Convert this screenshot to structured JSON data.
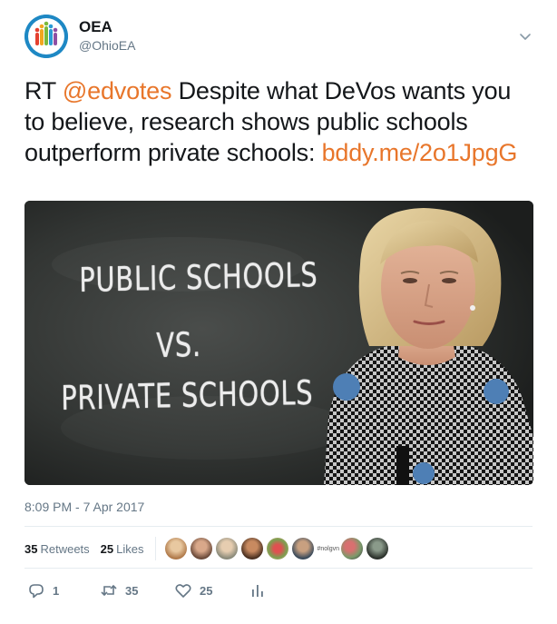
{
  "account": {
    "display_name": "OEA",
    "handle": "@OhioEA",
    "avatar_icon": "oea-logo-icon",
    "more_icon": "chevron-down-icon"
  },
  "tweet": {
    "prefix": "RT ",
    "mention": "@edvotes",
    "body": " Despite what DeVos wants you to believe, research shows public schools outperform private schools: ",
    "link": "bddy.me/2o1JpgG",
    "link_color": "#e8762b"
  },
  "media": {
    "chalk_line_1": "PUBLIC SCHOOLS",
    "chalk_line_2": "VS.",
    "chalk_line_3": "PRIVATE SCHOOLS"
  },
  "timestamp": "8:09 PM - 7 Apr 2017",
  "stats": {
    "retweets_count": "35",
    "retweets_label": "Retweets",
    "likes_count": "25",
    "likes_label": "Likes",
    "liker_handle_text": "#nolgvn",
    "liker_avatar_colors": [
      "#c9a07a",
      "#8a6a4f",
      "#b89a7a",
      "#6b4a3a",
      "#a87860",
      "#5c6a78",
      "#9a8a7a",
      "#4a5040"
    ]
  },
  "actions": {
    "reply_count": "1",
    "retweet_count": "35",
    "like_count": "25",
    "reply_icon": "reply-icon",
    "retweet_icon": "retweet-icon",
    "like_icon": "heart-icon",
    "analytics_icon": "analytics-icon"
  }
}
